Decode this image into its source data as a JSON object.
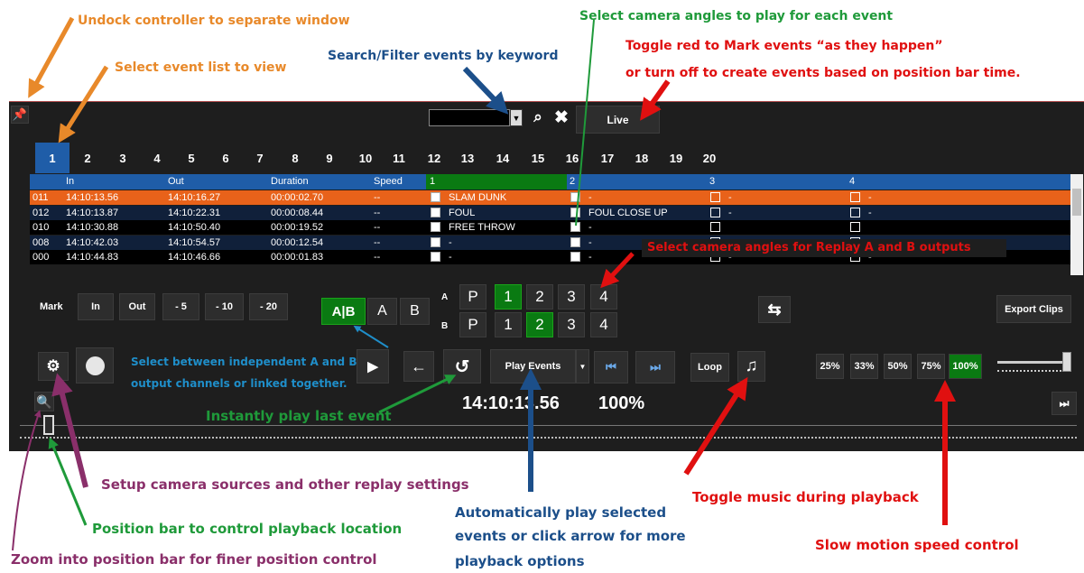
{
  "annotations": {
    "undock": "Undock controller to separate window",
    "event_list": "Select event list to view",
    "search": "Search/Filter events by keyword",
    "camera_each": "Select camera angles to play for each event",
    "toggle_red_1": "Toggle red to Mark events “as they happen”",
    "toggle_red_2": "or turn off to create events based on position bar time.",
    "replay_ab": "Select camera angles for Replay A and B outputs",
    "independent_1": "Select between independent A and B",
    "independent_2": "output channels or linked together.",
    "instant": "Instantly play last event",
    "setup": "Setup camera sources and other replay settings",
    "position": "Position bar to control playback location",
    "zoom": "Zoom into position bar for finer position control",
    "auto_1": "Automatically play selected",
    "auto_2": "events or click arrow for more",
    "auto_3": "playback options",
    "music": "Toggle music during playback",
    "slowmo": "Slow motion speed control"
  },
  "toolbar": {
    "live_label": "Live",
    "search_value": ""
  },
  "tabs": [
    "1",
    "2",
    "3",
    "4",
    "5",
    "6",
    "7",
    "8",
    "9",
    "10",
    "11",
    "12",
    "13",
    "14",
    "15",
    "16",
    "17",
    "18",
    "19",
    "20"
  ],
  "columns": {
    "in": "In",
    "out": "Out",
    "duration": "Duration",
    "speed": "Speed",
    "cam1": "1",
    "cam2": "2",
    "cam3": "3",
    "cam4": "4"
  },
  "rows": [
    {
      "id": "011",
      "in": "14:10:13.56",
      "out": "14:10:16.27",
      "duration": "00:00:02.70",
      "speed": "--",
      "c1": "SLAM DUNK",
      "c2": "-",
      "c3": "-",
      "c4": "-"
    },
    {
      "id": "012",
      "in": "14:10:13.87",
      "out": "14:10:22.31",
      "duration": "00:00:08.44",
      "speed": "--",
      "c1": "FOUL",
      "c2": "FOUL CLOSE UP",
      "c3": "-",
      "c4": "-"
    },
    {
      "id": "010",
      "in": "14:10:30.88",
      "out": "14:10:50.40",
      "duration": "00:00:19.52",
      "speed": "--",
      "c1": "FREE THROW",
      "c2": "-",
      "c3": "",
      "c4": ""
    },
    {
      "id": "008",
      "in": "14:10:42.03",
      "out": "14:10:54.57",
      "duration": "00:00:12.54",
      "speed": "--",
      "c1": "-",
      "c2": "-",
      "c3": "",
      "c4": ""
    },
    {
      "id": "000",
      "in": "14:10:44.83",
      "out": "14:10:46.66",
      "duration": "00:00:01.83",
      "speed": "--",
      "c1": "-",
      "c2": "-",
      "c3": "-",
      "c4": "-"
    }
  ],
  "mark": {
    "mark": "Mark",
    "in": "In",
    "out": "Out",
    "m5": "- 5",
    "m10": "- 10",
    "m20": "- 20"
  },
  "ab_mode": {
    "linked": "A|B",
    "a": "A",
    "b": "B"
  },
  "replay": {
    "a_label": "A",
    "b_label": "B",
    "a": [
      "P",
      "1",
      "2",
      "3",
      "4"
    ],
    "b": [
      "P",
      "1",
      "2",
      "3",
      "4"
    ],
    "a_selected": "1",
    "b_selected": "2"
  },
  "export_label": "Export Clips",
  "play_events_label": "Play Events",
  "loop_label": "Loop",
  "timecode": "14:10:13.56",
  "speed_readout": "100%",
  "speeds": [
    "25%",
    "33%",
    "50%",
    "75%",
    "100%"
  ],
  "speed_selected": "100%",
  "colors": {
    "panel": "#1e1e1e",
    "selected_row": "#e8621a",
    "header": "#1f5da8",
    "green": "#0a7a12",
    "orange": "#e8892a",
    "blue": "#1c4f8a",
    "green_text": "#1f9a3a",
    "red": "#e01010",
    "purple": "#8a2f6a",
    "cyan": "#1f8ec9"
  }
}
